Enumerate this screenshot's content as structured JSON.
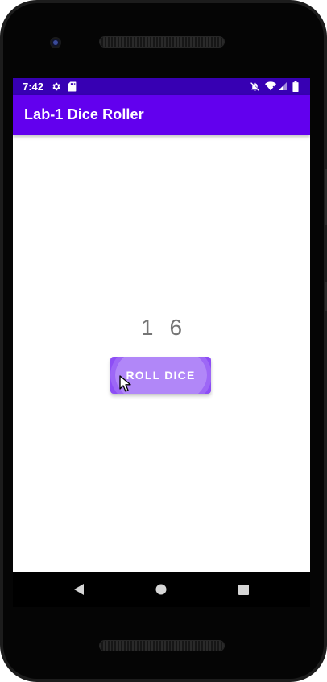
{
  "status_bar": {
    "time": "7:42",
    "icons": [
      "gear-icon",
      "sd-card-icon",
      "notifications-off-icon",
      "wifi-icon",
      "signal-icon",
      "battery-icon"
    ]
  },
  "app_bar": {
    "title": "Lab-1 Dice Roller"
  },
  "dice": {
    "die1": "1",
    "die2": "6"
  },
  "roll_button": {
    "label": "ROLL DICE"
  },
  "nav_bar": {
    "icons": [
      "back-icon",
      "home-icon",
      "recents-icon"
    ]
  },
  "colors": {
    "status_bar": "#3700b3",
    "app_bar": "#6200ee",
    "button": "#8d4ef5",
    "dice_text": "#757575"
  }
}
